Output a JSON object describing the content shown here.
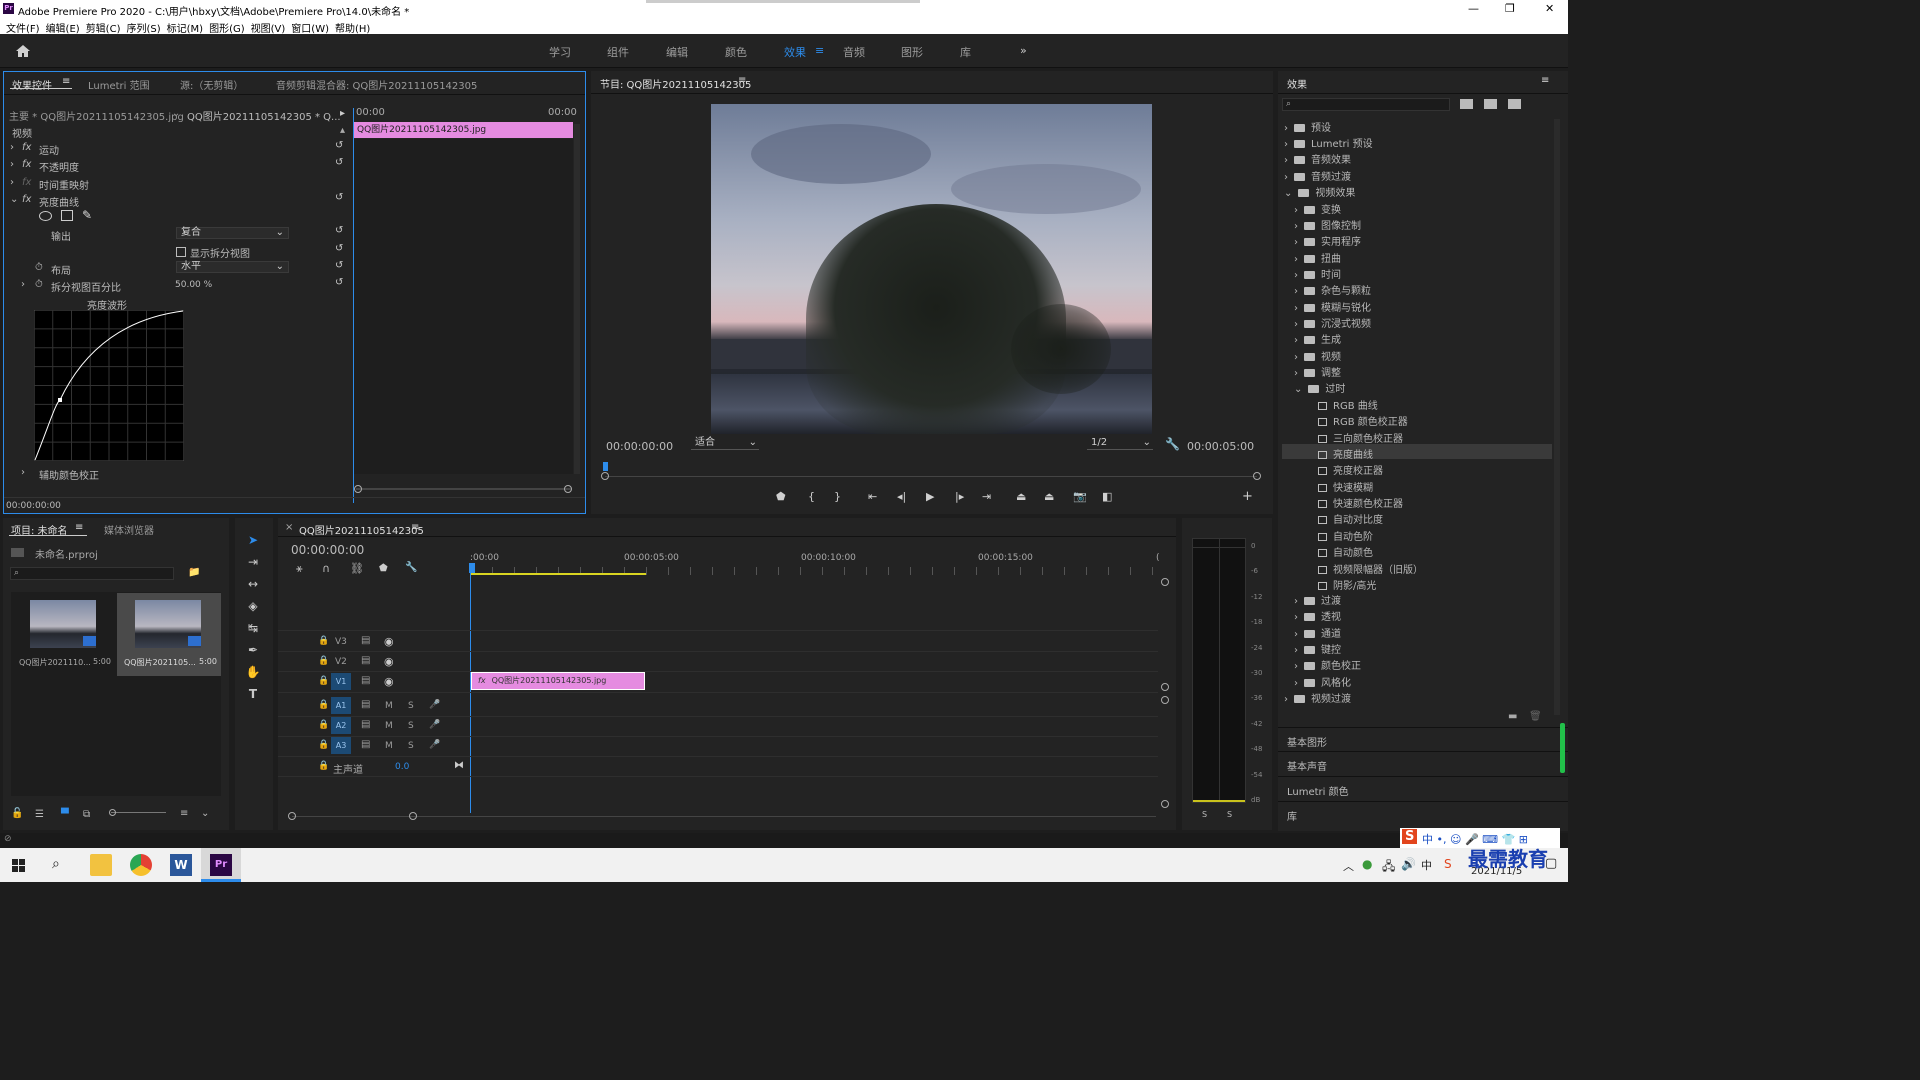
{
  "window": {
    "title": "Adobe Premiere Pro 2020 - C:\\用户\\hbxy\\文档\\Adobe\\Premiere Pro\\14.0\\未命名 *",
    "controls": [
      "—",
      "❐",
      "✕"
    ]
  },
  "menu": [
    "文件(F)",
    "编辑(E)",
    "剪辑(C)",
    "序列(S)",
    "标记(M)",
    "图形(G)",
    "视图(V)",
    "窗口(W)",
    "帮助(H)"
  ],
  "workspaces": [
    "学习",
    "组件",
    "编辑",
    "颜色",
    "效果",
    "音频",
    "图形",
    "库"
  ],
  "active_workspace": "效果",
  "effect_controls": {
    "tabs": [
      "效果控件",
      "Lumetri 范围",
      "源:（无剪辑）",
      "音频剪辑混合器: QQ图片20211105142305"
    ],
    "master": "主要 * QQ图片20211105142305.jpg",
    "clip": "QQ图片20211105142305 * Q...",
    "tc_start": "00:00",
    "tc_end": "00:00",
    "clip_bar": "QQ图片20211105142305.jpg",
    "section": "视频",
    "effects": [
      "运动",
      "不透明度",
      "时间重映射",
      "亮度曲线"
    ],
    "output_label": "输出",
    "output_value": "复合",
    "split_view_label": "显示拆分视图",
    "layout_label": "布局",
    "layout_value": "水平",
    "split_pct_label": "拆分视图百分比",
    "split_pct_value": "50.00 %",
    "curve_title": "亮度波形",
    "aux_label": "辅助颜色校正",
    "timecode": "00:00:00:00"
  },
  "program": {
    "title": "节目: QQ图片20211105142305",
    "timecode": "00:00:00:00",
    "fit": "适合",
    "res": "1/2",
    "duration": "00:00:05:00"
  },
  "effects_panel": {
    "title": "效果",
    "top": [
      "预设",
      "Lumetri 预设",
      "音频效果",
      "音频过渡",
      "视频效果"
    ],
    "video": [
      "变换",
      "图像控制",
      "实用程序",
      "扭曲",
      "时间",
      "杂色与颗粒",
      "模糊与锐化",
      "沉浸式视频",
      "生成",
      "视频",
      "调整",
      "过时"
    ],
    "obsolete": [
      "RGB 曲线",
      "RGB 颜色校正器",
      "三向颜色校正器",
      "亮度曲线",
      "亮度校正器",
      "快速模糊",
      "快速颜色校正器",
      "自动对比度",
      "自动色阶",
      "自动颜色",
      "视频限幅器（旧版）",
      "阴影/高光"
    ],
    "selected": "亮度曲线",
    "after": [
      "过渡",
      "透视",
      "通道",
      "键控",
      "颜色校正",
      "风格化"
    ],
    "bottom": "视频过渡",
    "extras": [
      "基本图形",
      "基本声音",
      "Lumetri 颜色",
      "库"
    ]
  },
  "project": {
    "tabs": [
      "项目: 未命名",
      "媒体浏览器"
    ],
    "file": "未命名.prproj",
    "items": [
      {
        "name": "QQ图片2021110...",
        "dur": "5:00"
      },
      {
        "name": "QQ图片2021105...",
        "dur": "5:00"
      }
    ]
  },
  "timeline": {
    "tab": "QQ图片20211105142305",
    "timecode": "00:00:00:00",
    "ruler": [
      ":00:00",
      "00:00:05:00",
      "00:00:10:00",
      "00:00:15:00"
    ],
    "video_tracks": [
      "V3",
      "V2",
      "V1"
    ],
    "audio_tracks": [
      "A1",
      "A2",
      "A3"
    ],
    "master": "主声道",
    "master_val": "0.0",
    "clip": "QQ图片20211105142305.jpg",
    "ms": [
      "M",
      "S"
    ]
  },
  "meter": {
    "scale": [
      "0",
      "-6",
      "-12",
      "-18",
      "-24",
      "-30",
      "-36",
      "-42",
      "-48",
      "-54",
      "dB"
    ],
    "solo": [
      "S",
      "S"
    ]
  },
  "taskbar": {
    "date": "2021/11/5",
    "watermark": "最需教育"
  }
}
